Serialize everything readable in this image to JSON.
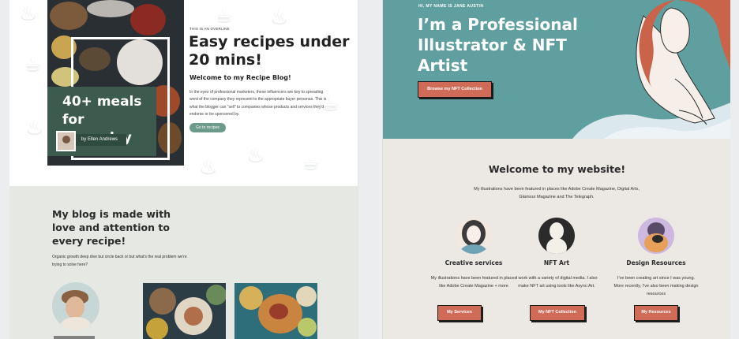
{
  "left_page": {
    "hero": {
      "image_title": "40+ meals for everyday",
      "author_tag": "by Ellen Andrews",
      "overline": "THIS IS AN OVERLINE",
      "title": "Easy recipes under 20 mins!",
      "subtitle": "Welcome to my Recipe Blog!",
      "body": "In the eyes of professional marketers, these influencers are key to spreading word of the company they represent to the appropriate buyer personas. This is what the blogger can “sell” to companies whose products and services they'd endorse or be sponsored by.",
      "cta_label": "Go to recipes"
    },
    "blog": {
      "title": "My blog is made with love and attention to every recipe!",
      "body": "Organic growth deep dive but circle back or but what's the real problem we're trying to solve here?"
    }
  },
  "right_page": {
    "hero": {
      "overline": "HI, MY NAME IS JANE AUSTIN",
      "title": "I’m a Professional Illustrator & NFT Artist",
      "cta_label": "Browse my NFT Collection"
    },
    "welcome": {
      "title": "Welcome to my website!",
      "body": "My illustrations have been featured in places like Adobe Create Magazine, Digital Arts, Glamour Magazine and The Telegraph."
    },
    "services": [
      {
        "title": "Creative services",
        "body": "My illustrations have been featured in places like Adobe Create Magazine + more",
        "button": "My Services"
      },
      {
        "title": "NFT Art",
        "body": "I work with a variety of digital media. I also make NFT art using tools like Async:Art.",
        "button": "My NFT Collection"
      },
      {
        "title": "Design Resources",
        "body": "I’ve been creating art since I was young. More recently, I’ve also been making design resources",
        "button": "My Resources"
      }
    ]
  },
  "colors": {
    "recipe_green": "#3d5a4e",
    "recipe_button": "#6c9a8b",
    "recipe_section_bg": "#e5e8e3",
    "artist_teal": "#5f9f9f",
    "artist_coral": "#cf6b57",
    "artist_section_bg": "#ece8e4"
  }
}
